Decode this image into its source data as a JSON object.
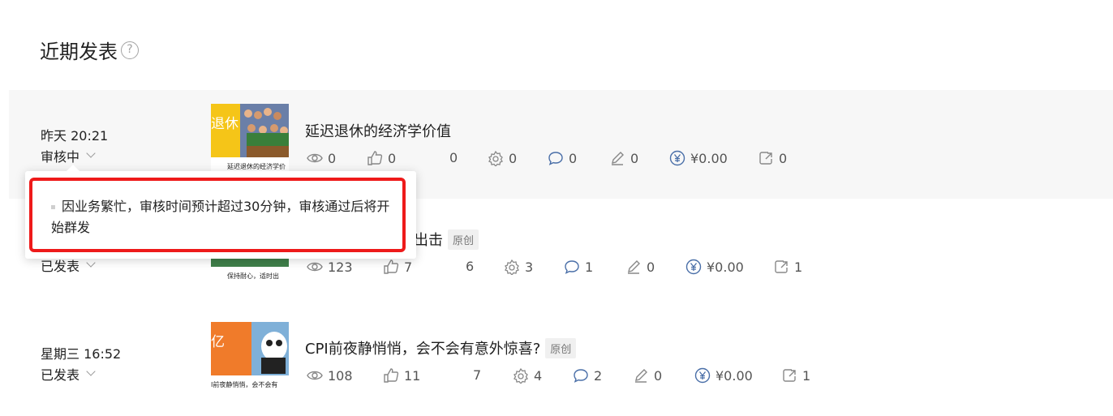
{
  "section": {
    "title": "近期发表",
    "help_glyph": "?"
  },
  "posts": [
    {
      "time": "昨天 20:21",
      "status": "审核中",
      "title": "延迟退休的经济学价值",
      "badge": "",
      "thumb_text": "退休",
      "thumb_caption": "延迟退休的经济学价",
      "stats": {
        "views": "0",
        "likes": "0",
        "watching": "0",
        "recommend": "0",
        "comments": "0",
        "notes": "0",
        "earnings": "¥0.00",
        "shares": "0"
      }
    },
    {
      "time": "",
      "status": "已发表",
      "title": "出击",
      "badge": "原创",
      "thumb_caption": "保持耐心，适时出",
      "stats": {
        "views": "123",
        "likes": "7",
        "watching": "6",
        "recommend": "3",
        "comments": "1",
        "notes": "0",
        "earnings": "¥0.00",
        "shares": "1"
      }
    },
    {
      "time": "星期三 16:52",
      "status": "已发表",
      "title": "CPI前夜静悄悄，会不会有意外惊喜?",
      "badge": "原创",
      "thumb_text": "亿",
      "thumb_caption": "I前夜静悄悄，会不会有",
      "stats": {
        "views": "108",
        "likes": "11",
        "watching": "7",
        "recommend": "4",
        "comments": "2",
        "notes": "0",
        "earnings": "¥0.00",
        "shares": "1"
      }
    }
  ],
  "tooltip": {
    "text": "因业务繁忙，审核时间预计超过30分钟，审核通过后将开始群发"
  },
  "colors": {
    "highlight_border": "#ee1a1a",
    "row_highlight": "#f7f7f7",
    "thumb_yellow": "#f5c518",
    "thumb_orange": "#f07b2a"
  },
  "icons": [
    "help-icon",
    "eye-icon",
    "thumb-up-icon",
    "gear-icon",
    "comment-icon",
    "pen-icon",
    "yuan-icon",
    "share-icon",
    "chevron-down-icon"
  ]
}
